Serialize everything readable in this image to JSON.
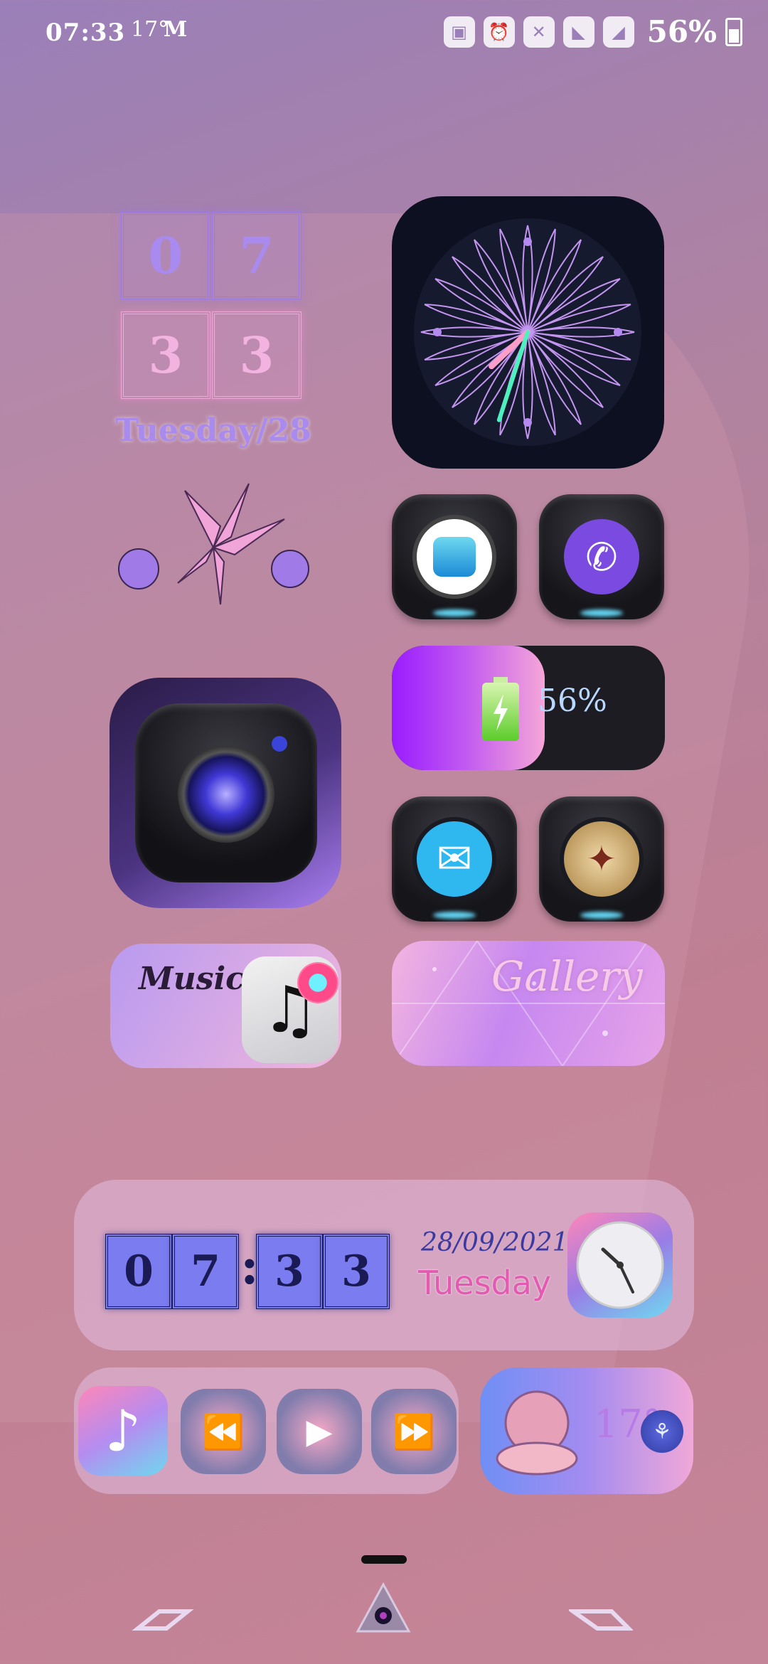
{
  "status_bar": {
    "time": "07:33",
    "temperature": "17°",
    "notification_icon": "M",
    "battery_percent": "56%",
    "icons": [
      "battery-saver-icon",
      "alarm-icon",
      "mute-icon",
      "wifi-icon",
      "signal-icon"
    ]
  },
  "clock_widget": {
    "hour_digits": [
      "0",
      "7"
    ],
    "minute_digits": [
      "3",
      "3"
    ],
    "day_label": "Tuesday/28"
  },
  "analog_clock": {
    "hour": 7,
    "minute": 33
  },
  "apps": {
    "app_store": "app-store-icon",
    "viber": "viber-icon",
    "camera": "camera-icon",
    "mail": "mail-icon",
    "compass": "compass-icon"
  },
  "battery_widget": {
    "percent_label": "56%",
    "level": 0.56
  },
  "music_widget": {
    "label": "Music"
  },
  "gallery_widget": {
    "label": "Gallery"
  },
  "datetime_widget": {
    "digits": [
      "0",
      "7",
      "3",
      "3"
    ],
    "date": "28/09/2021",
    "day": "Tuesday"
  },
  "player_widget": {
    "buttons": [
      "rewind-icon",
      "play-icon",
      "fast-forward-icon"
    ]
  },
  "weather_widget": {
    "temperature": "17°",
    "badge": "⚘"
  },
  "colors": {
    "accent_purple": "#a98bf0",
    "accent_pink": "#f2b3e0",
    "battery_gradient_start": "#9a1cff",
    "battery_gradient_end": "#f5a6d8"
  }
}
